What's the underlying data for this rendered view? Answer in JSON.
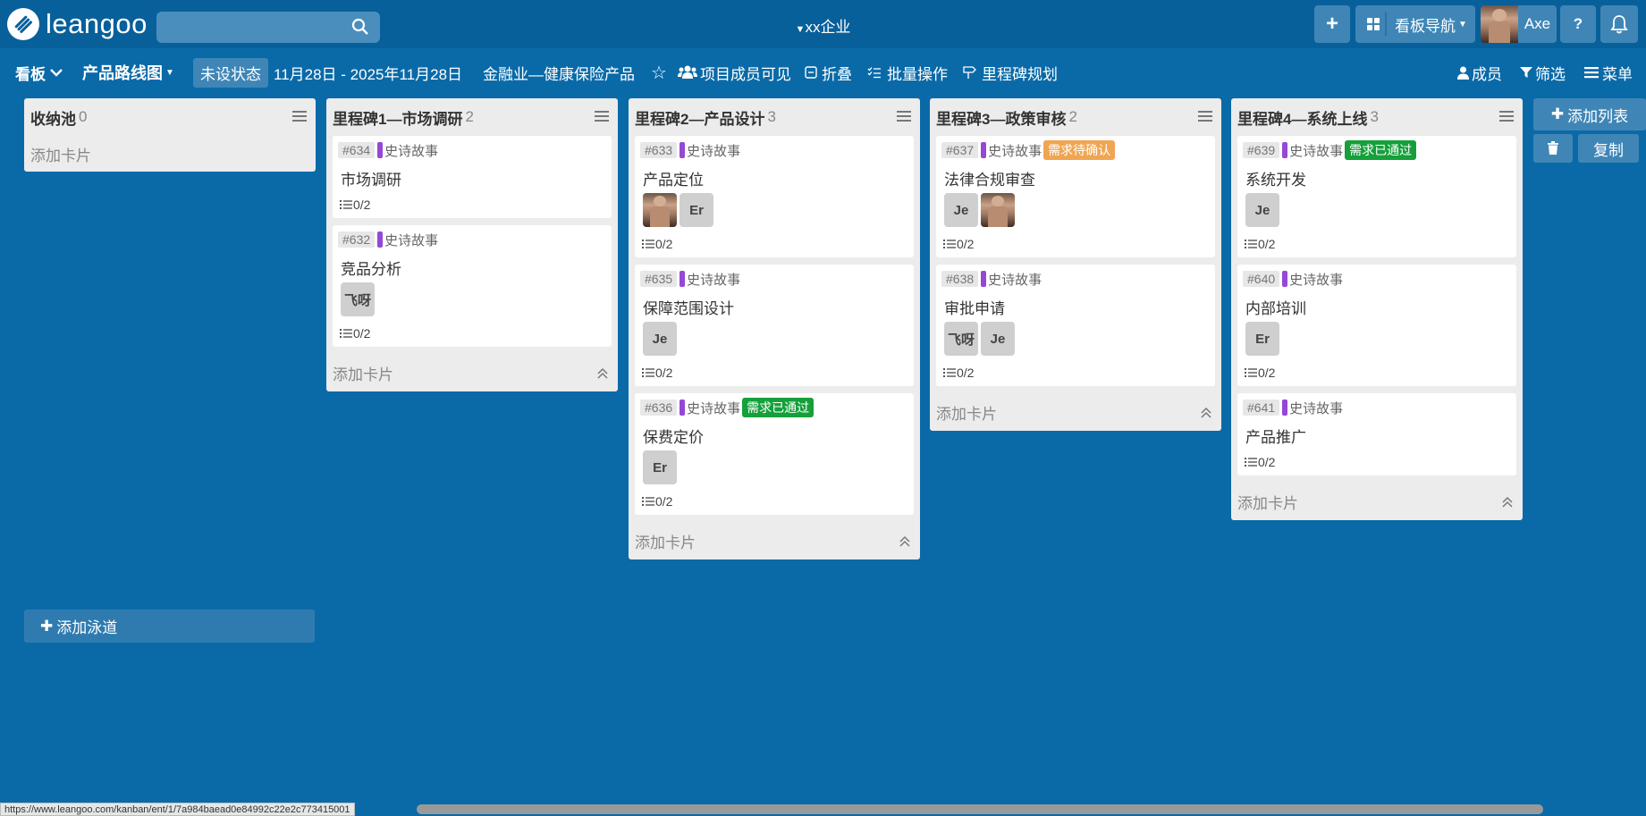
{
  "header": {
    "logo_text": "leangoo",
    "search_placeholder": "",
    "org_name": "xx企业",
    "add_label": "+",
    "board_nav_label": "看板导航",
    "user_name": "Axe",
    "help_label": "?"
  },
  "toolbar": {
    "board_menu": "看板",
    "board_name": "产品路线图",
    "status": "未设状态",
    "date_range": "11月28日 - 2025年11月28日",
    "project": "金融业—健康保险产品",
    "visibility": "项目成员可见",
    "fold": "折叠",
    "batch": "批量操作",
    "milestone": "里程碑规划",
    "members": "成员",
    "filter": "筛选",
    "menu": "菜单"
  },
  "lists": [
    {
      "title": "收纳池",
      "count": "0",
      "add_card": "添加卡片",
      "cards": []
    },
    {
      "title": "里程碑1—市场调研",
      "count": "2",
      "add_card": "添加卡片",
      "cards": [
        {
          "id": "#634",
          "epic": "史诗故事",
          "tag": "",
          "title": "市场调研",
          "members": [],
          "checklist": "0/2"
        },
        {
          "id": "#632",
          "epic": "史诗故事",
          "tag": "",
          "title": "竞品分析",
          "members": [
            "飞呀"
          ],
          "checklist": "0/2"
        }
      ]
    },
    {
      "title": "里程碑2—产品设计",
      "count": "3",
      "add_card": "添加卡片",
      "cards": [
        {
          "id": "#633",
          "epic": "史诗故事",
          "tag": "",
          "title": "产品定位",
          "members": [
            "photo",
            "Er"
          ],
          "checklist": "0/2"
        },
        {
          "id": "#635",
          "epic": "史诗故事",
          "tag": "",
          "title": "保障范围设计",
          "members": [
            "Je"
          ],
          "checklist": "0/2"
        },
        {
          "id": "#636",
          "epic": "史诗故事",
          "tag": "需求已通过",
          "tag_color": "#15a03a",
          "title": "保费定价",
          "members": [
            "Er"
          ],
          "checklist": "0/2"
        }
      ]
    },
    {
      "title": "里程碑3—政策审核",
      "count": "2",
      "add_card": "添加卡片",
      "cards": [
        {
          "id": "#637",
          "epic": "史诗故事",
          "tag": "需求待确认",
          "tag_color": "#f0a552",
          "title": "法律合规审查",
          "members": [
            "Je",
            "photo"
          ],
          "checklist": "0/2"
        },
        {
          "id": "#638",
          "epic": "史诗故事",
          "tag": "",
          "title": "审批申请",
          "members": [
            "飞呀",
            "Je"
          ],
          "checklist": "0/2"
        }
      ]
    },
    {
      "title": "里程碑4—系统上线",
      "count": "3",
      "add_card": "添加卡片",
      "cards": [
        {
          "id": "#639",
          "epic": "史诗故事",
          "tag": "需求已通过",
          "tag_color": "#15a03a",
          "title": "系统开发",
          "members": [
            "Je"
          ],
          "checklist": "0/2"
        },
        {
          "id": "#640",
          "epic": "史诗故事",
          "tag": "",
          "title": "内部培训",
          "members": [
            "Er"
          ],
          "checklist": "0/2"
        },
        {
          "id": "#641",
          "epic": "史诗故事",
          "tag": "",
          "title": "产品推广",
          "members": [],
          "checklist": "0/2"
        }
      ]
    }
  ],
  "board_actions": {
    "add_list": "添加列表",
    "copy": "复制",
    "add_swimlane": "添加泳道"
  },
  "statusbar_url": "https://www.leangoo.com/kanban/ent/1/7a984baead0e84992c22e2c773415001",
  "colors": {
    "background": "#0a6aa8",
    "header": "#08609b",
    "epic": "#9547d6"
  }
}
